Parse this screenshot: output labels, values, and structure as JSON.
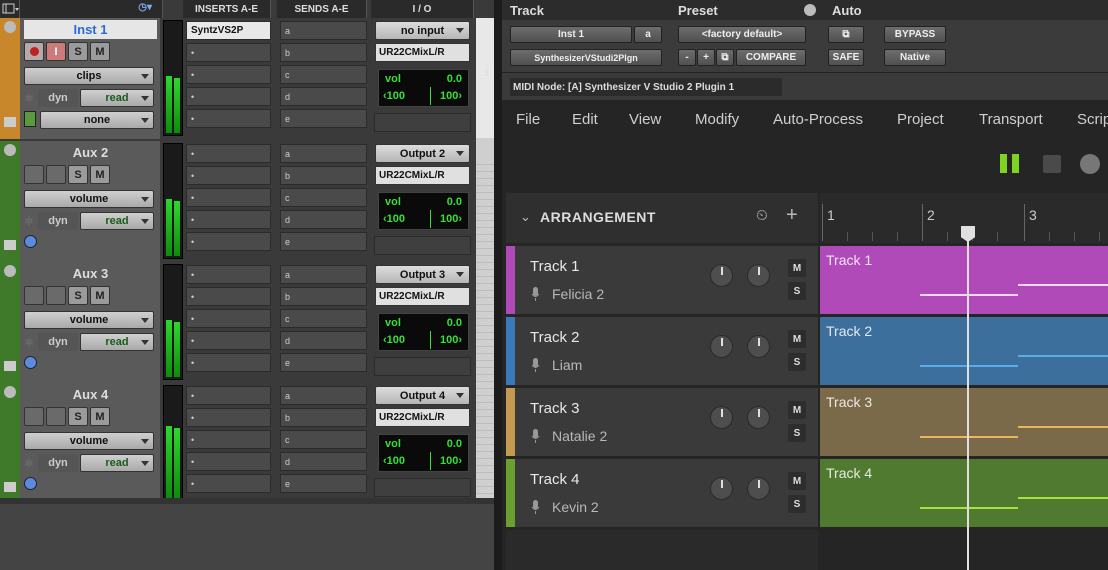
{
  "mix": {
    "headers": {
      "inserts": "INSERTS A-E",
      "sends": "SENDS A-E",
      "io": "I / O"
    },
    "tracks": [
      {
        "name": "Inst 1",
        "auto_label": "clips",
        "dyn": "dyn",
        "read": "read",
        "extra": "none",
        "insert": "SyntzVS2P",
        "input": "no input",
        "output": "UR22CMixL/R",
        "vol_label": "vol",
        "vol_value": "0.0",
        "pan_l": "‹100",
        "pan_r": "100›",
        "sends": [
          "a",
          "b",
          "c",
          "d",
          "e"
        ],
        "color": "#c8872a"
      },
      {
        "name": "Aux 2",
        "auto_label": "volume",
        "dyn": "dyn",
        "read": "read",
        "extra": "",
        "insert": "",
        "input": "Output 2",
        "output": "UR22CMixL/R",
        "vol_label": "vol",
        "vol_value": "0.0",
        "pan_l": "‹100",
        "pan_r": "100›",
        "sends": [
          "a",
          "b",
          "c",
          "d",
          "e"
        ],
        "color": "#3f7a2a"
      },
      {
        "name": "Aux 3",
        "auto_label": "volume",
        "dyn": "dyn",
        "read": "read",
        "extra": "",
        "insert": "",
        "input": "Output 3",
        "output": "UR22CMixL/R",
        "vol_label": "vol",
        "vol_value": "0.0",
        "pan_l": "‹100",
        "pan_r": "100›",
        "sends": [
          "a",
          "b",
          "c",
          "d",
          "e"
        ],
        "color": "#3f7a2a"
      },
      {
        "name": "Aux 4",
        "auto_label": "volume",
        "dyn": "dyn",
        "read": "read",
        "extra": "",
        "insert": "",
        "input": "Output 4",
        "output": "UR22CMixL/R",
        "vol_label": "vol",
        "vol_value": "0.0",
        "pan_l": "‹100",
        "pan_r": "100›",
        "sends": [
          "a",
          "b",
          "c",
          "d",
          "e"
        ],
        "color": "#3f7a2a"
      }
    ],
    "buttons": {
      "solo": "S",
      "mute": "M",
      "input_mon": "I"
    },
    "bus_marker": "3"
  },
  "plugin": {
    "track_label": "Track",
    "preset_label": "Preset",
    "auto_label": "Auto",
    "track_select": "Inst 1",
    "track_letter": "a",
    "plugin_select": "SynthesizerVStudi2Plgn",
    "preset_select": "<factory default>",
    "minus": "-",
    "plus": "+",
    "compare": "COMPARE",
    "bypass": "BYPASS",
    "safe": "SAFE",
    "native": "Native",
    "midi_node": "MIDI Node: [A] Synthesizer V Studio 2 Plugin 1"
  },
  "synth": {
    "menu": [
      "File",
      "Edit",
      "View",
      "Modify",
      "Auto-Process",
      "Project",
      "Transport",
      "Scrip"
    ],
    "arrangement_label": "ARRANGEMENT",
    "ruler": [
      "1",
      "2",
      "3"
    ],
    "tracks": [
      {
        "name": "Track 1",
        "voice": "Felicia 2",
        "color": "#b04ab8",
        "lane": "#b04ab8",
        "lane_label": "Track 1",
        "note_color": "#f0d8f0"
      },
      {
        "name": "Track 2",
        "voice": "Liam",
        "color": "#3a7ab8",
        "lane": "#3c6f9c",
        "lane_label": "Track 2",
        "note_color": "#5aaee8"
      },
      {
        "name": "Track 3",
        "voice": "Natalie 2",
        "color": "#c49a50",
        "lane": "#7a6a4a",
        "lane_label": "Track 3",
        "note_color": "#e8b860"
      },
      {
        "name": "Track 4",
        "voice": "Kevin 2",
        "color": "#6aa030",
        "lane": "#4f7a30",
        "lane_label": "Track 4",
        "note_color": "#a8e040"
      }
    ],
    "track_buttons": {
      "mute": "M",
      "solo": "S"
    },
    "colors": {
      "play_green": "#7ed321",
      "playhead": "#e0e0e0"
    }
  }
}
